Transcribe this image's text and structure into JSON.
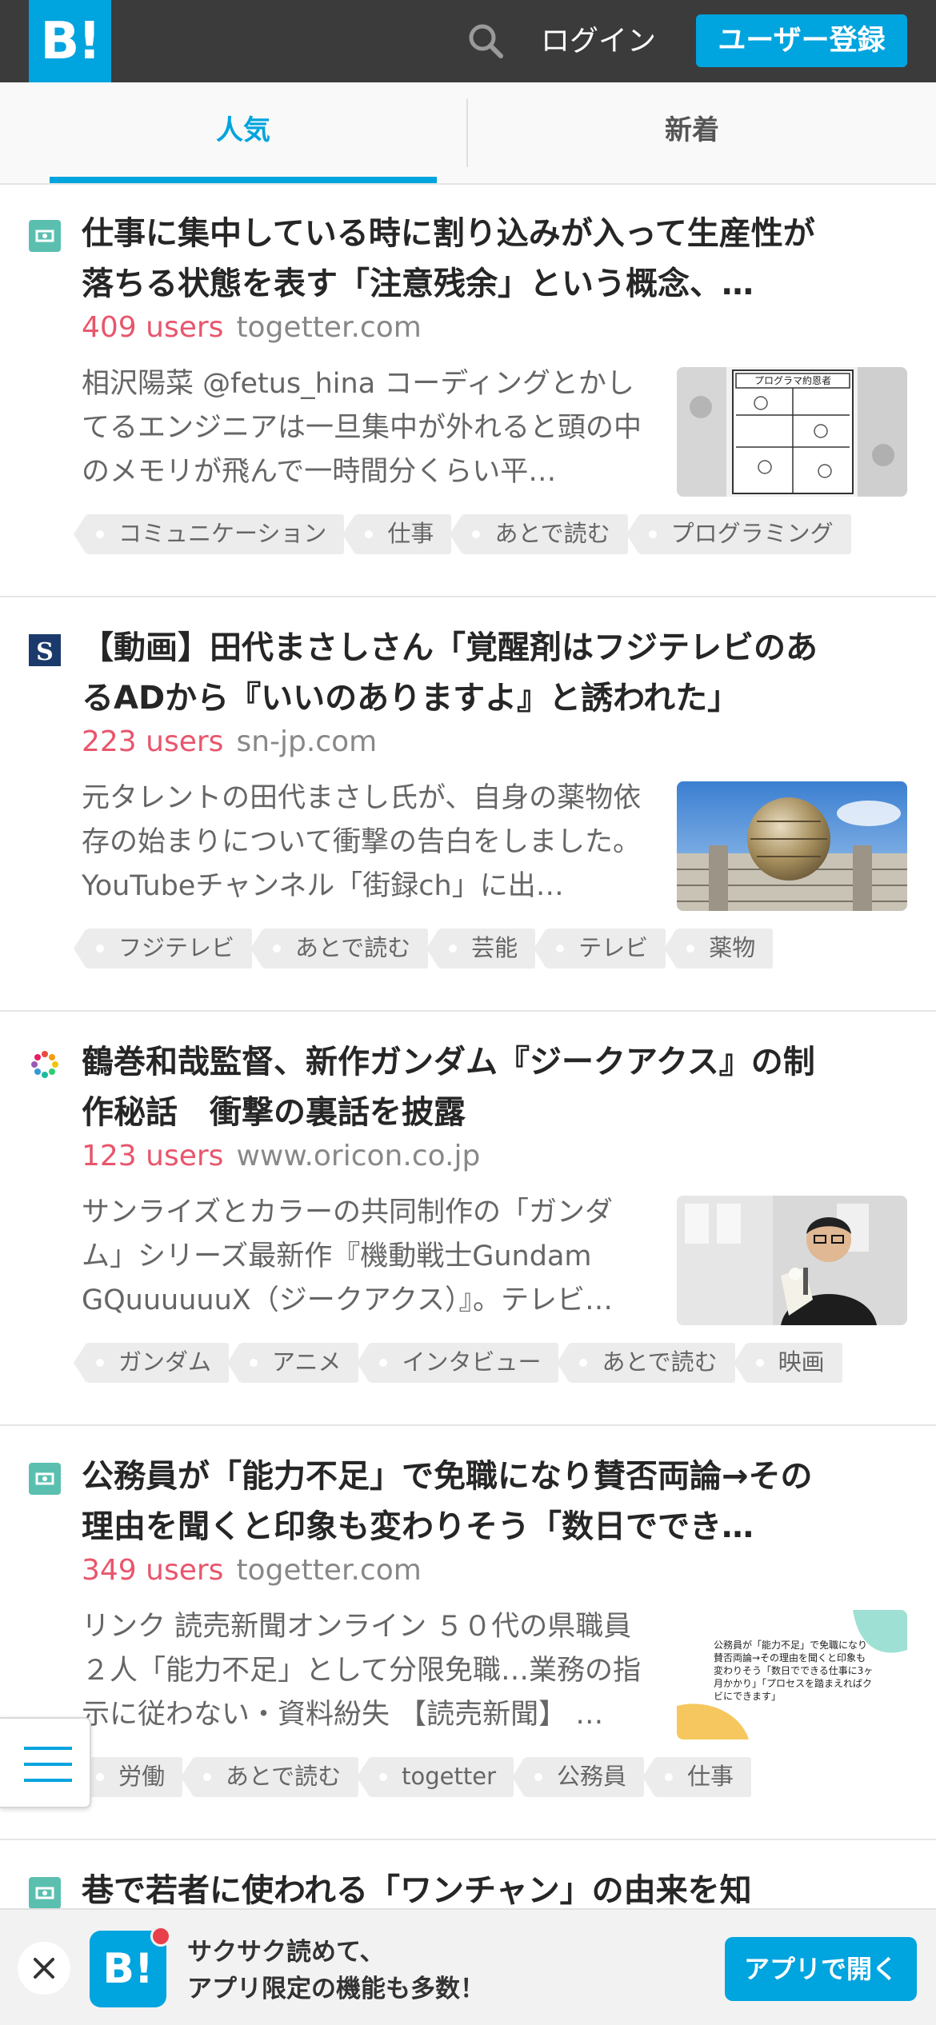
{
  "header": {
    "logo_text": "B!",
    "login_label": "ログイン",
    "register_label": "ユーザー登録",
    "accent_color": "#00a4de"
  },
  "tabs": [
    {
      "label": "人気",
      "active": true
    },
    {
      "label": "新着",
      "active": false
    }
  ],
  "entries": [
    {
      "favicon": "togetter-icon",
      "title": "仕事に集中している時に割り込みが入って生産性が落ちる状態を表す「注意残余」という概念、…",
      "users": "409 users",
      "domain": "togetter.com",
      "description": "相沢陽菜 @fetus_hina コーディングとかしてるエンジニアは一旦集中が外れると頭の中のメモリが飛んで一時間分くらい平…",
      "thumbnail": "manga-programmer-thumbnail",
      "thumb_caption": "プログラマ約恩者",
      "tags": [
        "コミュニケーション",
        "仕事",
        "あとで読む",
        "プログラミング"
      ]
    },
    {
      "favicon": "sn-jp-icon",
      "title": "【動画】田代まさしさん「覚醒剤はフジテレビのあるADから『いいのありますよ』と誘われた」",
      "users": "223 users",
      "domain": "sn-jp.com",
      "description": "元タレントの田代まさし氏が、自身の薬物依存の始まりについて衝撃の告白をしました。 YouTubeチャンネル「街録ch」に出…",
      "thumbnail": "fuji-tv-building-thumbnail",
      "tags": [
        "フジテレビ",
        "あとで読む",
        "芸能",
        "テレビ",
        "薬物"
      ]
    },
    {
      "favicon": "oricon-icon",
      "title": "鶴巻和哉監督、新作ガンダム『ジークアクス』の制作秘話　衝撃の裏話を披露",
      "users": "123 users",
      "domain": "www.oricon.co.jp",
      "description": "サンライズとカラーの共同制作の「ガンダム」シリーズ最新作『機動戦士Gundam GQuuuuuuX（ジークアクス）』。テレビ…",
      "thumbnail": "director-photo-thumbnail",
      "tags": [
        "ガンダム",
        "アニメ",
        "インタビュー",
        "あとで読む",
        "映画"
      ]
    },
    {
      "favicon": "togetter-icon",
      "title": "公務員が「能力不足」で免職になり賛否両論→その理由を聞くと印象も変わりそう「数日ででき…",
      "users": "349 users",
      "domain": "togetter.com",
      "description": "リンク 読売新聞オンライン ５０代の県職員２人「能力不足」として分限免職…業務の指示に従わない・資料紛失 【読売新聞】 …",
      "thumbnail": "text-card-thumbnail",
      "thumb_caption": "公務員が「能力不足」で免職になり賛否両論→その理由を聞くと印象も変わりそう「数日でできる仕事に3ヶ月かかり」「プロセスを踏まえればクビにできます」",
      "tags": [
        "労働",
        "あとで読む",
        "togetter",
        "公務員",
        "仕事"
      ]
    },
    {
      "favicon": "togetter-icon",
      "title": "巷で若者に使われる「ワンチャン」の由来を知"
    }
  ],
  "banner": {
    "line1": "サクサク読めて、",
    "line2": "アプリ限定の機能も多数！",
    "open_label": "アプリで開く",
    "app_icon_text": "B!"
  }
}
